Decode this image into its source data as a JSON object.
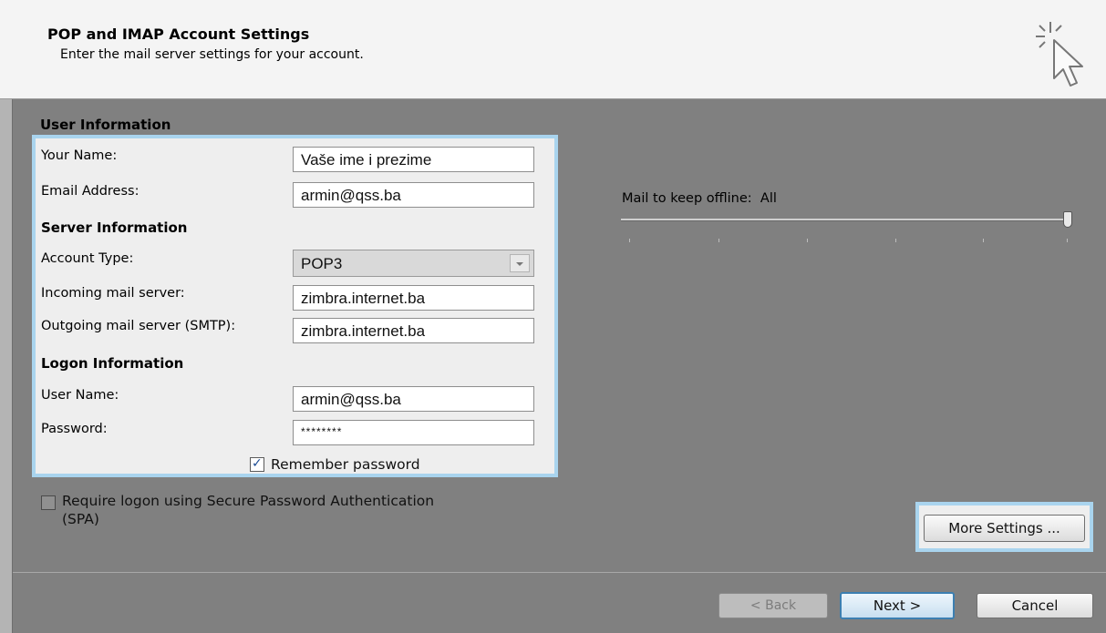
{
  "header": {
    "title": "POP and IMAP Account Settings",
    "subtitle": "Enter the mail server settings for your account."
  },
  "user_info": {
    "heading": "User Information",
    "name_label": "Your Name:",
    "name_value": "Vaše ime i prezime",
    "email_label": "Email Address:",
    "email_value": "armin@qss.ba"
  },
  "server_info": {
    "heading": "Server Information",
    "account_type_label": "Account Type:",
    "account_type_value": "POP3",
    "incoming_label": "Incoming mail server:",
    "incoming_value": "zimbra.internet.ba",
    "outgoing_label": "Outgoing mail server (SMTP):",
    "outgoing_value": "zimbra.internet.ba"
  },
  "logon_info": {
    "heading": "Logon Information",
    "username_label": "User Name:",
    "username_value": "armin@qss.ba",
    "password_label": "Password:",
    "password_value": "********",
    "remember_label": "Remember password",
    "remember_checked": true,
    "spa_label_line1": "Require logon using Secure Password Authentication",
    "spa_label_line2": "(SPA)",
    "spa_checked": false
  },
  "offline": {
    "label": "Mail to keep offline:",
    "value": "All",
    "slider_fraction": 1.0
  },
  "buttons": {
    "more_settings": "More Settings ...",
    "back": "< Back",
    "next": "Next >",
    "cancel": "Cancel"
  },
  "colors": {
    "highlight": "#a9d4ee",
    "background": "#808080"
  },
  "icons": {
    "wizard": "cursor-sparkle-icon",
    "checkmark": "checkmark-icon",
    "dropdown": "chevron-down-icon"
  }
}
